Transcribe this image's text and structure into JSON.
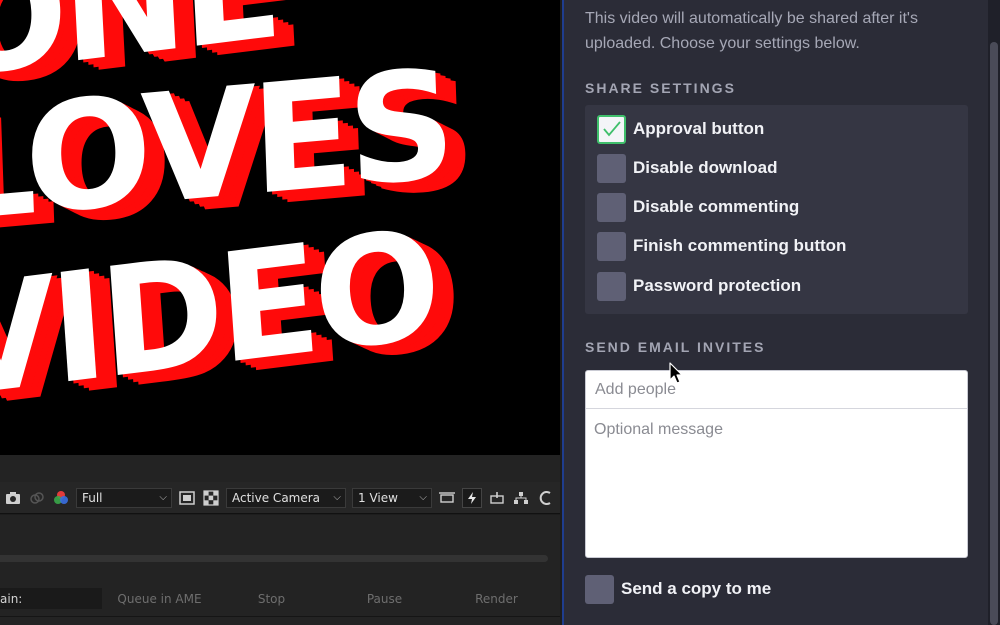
{
  "viewer": {
    "lines": [
      "ONE",
      "LOVES",
      "VIDEO"
    ]
  },
  "toolbar": {
    "resolution": "Full",
    "camera": "Active Camera",
    "views": "1 View"
  },
  "render_queue": {
    "main_label": "ain:",
    "queue_in_ame": "Queue in AME",
    "stop": "Stop",
    "pause": "Pause",
    "render": "Render"
  },
  "share_panel": {
    "intro": "This video will automatically be shared after it's uploaded. Choose your settings below.",
    "share_settings_heading": "SHARE SETTINGS",
    "options": [
      {
        "label": "Approval button",
        "checked": true
      },
      {
        "label": "Disable download",
        "checked": false
      },
      {
        "label": "Disable commenting",
        "checked": false
      },
      {
        "label": "Finish commenting button",
        "checked": false
      },
      {
        "label": "Password protection",
        "checked": false
      }
    ],
    "email_heading": "SEND EMAIL INVITES",
    "add_people_placeholder": "Add people",
    "message_placeholder": "Optional message",
    "send_copy_label": "Send a copy to me",
    "send_copy_checked": false
  },
  "colors": {
    "accent_check": "#3fbf6b",
    "panel_bg": "#2b2c37",
    "text_red": "#ff0a0a"
  }
}
